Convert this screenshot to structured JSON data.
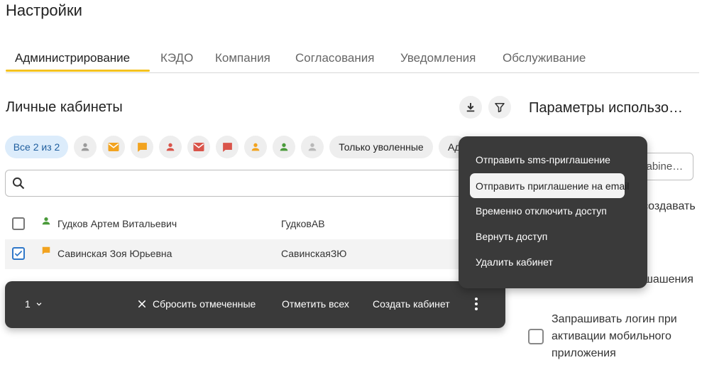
{
  "page": {
    "title": "Настройки"
  },
  "tabs": [
    "Администрирование",
    "КЭДО",
    "Компания",
    "Согласования",
    "Уведомления",
    "Обслуживание"
  ],
  "section": {
    "title": "Личные кабинеты"
  },
  "params": {
    "title": "Параметры использо…",
    "input_value": "cabine…",
    "text_1": "создавать",
    "text_2": "шашения",
    "checkbox_label_lines": [
      "Запрашивать логин при",
      "активации мобильного",
      "приложения"
    ]
  },
  "filters": {
    "all_label": "Все 2 из 2",
    "fired_label": "Только уволенные",
    "next_label": "Ад",
    "icon_chips": [
      "person-icon",
      "email-icon",
      "chat-icon",
      "person-icon",
      "email-icon",
      "chat-icon",
      "person-icon",
      "person-icon",
      "person-icon"
    ]
  },
  "search": {
    "placeholder": ""
  },
  "rows": [
    {
      "name": "Гудков Артем Витальевич",
      "login": "ГудковАВ",
      "checked": false,
      "icon": "person-icon",
      "icon_color": "#4a9a3a"
    },
    {
      "name": "Савинская Зоя Юрьевна",
      "login": "СавинскаяЗЮ",
      "checked": true,
      "icon": "chat-icon",
      "icon_color": "#f2a31f"
    }
  ],
  "action_bar": {
    "count": "1",
    "reset_label": "Сбросить отмеченные",
    "select_all_label": "Отметить всех",
    "create_label": "Создать кабинет"
  },
  "menu": {
    "items": [
      "Отправить sms-приглашение",
      "Отправить приглашение на email",
      "Временно отключить доступ",
      "Вернуть доступ",
      "Удалить кабинет"
    ]
  },
  "colors": {
    "accent": "#f4c21f",
    "grey_icon": "#9a9a9a",
    "orange_icon": "#f2a31f",
    "red_icon": "#d9544a",
    "green_icon": "#4a9a3a",
    "selected_chip_bg": "#dcecfb",
    "dark_panel": "#3a3a3a"
  }
}
